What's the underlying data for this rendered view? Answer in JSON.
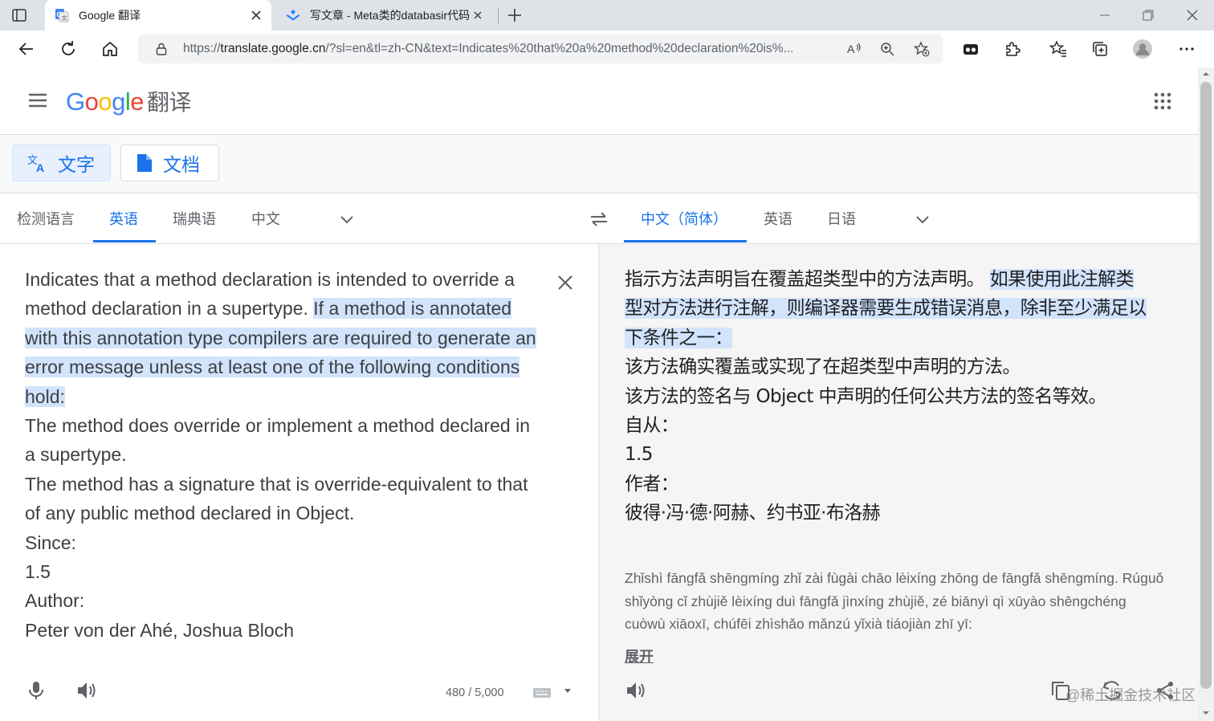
{
  "browser": {
    "tabs": [
      {
        "title": "Google 翻译",
        "active": true
      },
      {
        "title": "写文章 - Meta类的databasir代码",
        "active": false
      }
    ],
    "url_prefix": "https://",
    "url_host": "translate.google.cn",
    "url_rest": "/?sl=en&tl=zh-CN&text=Indicates%20that%20a%20method%20declaration%20is%..."
  },
  "header": {
    "logo_google": "Google",
    "logo_product": "翻译"
  },
  "modes": [
    {
      "label": "文字",
      "active": true
    },
    {
      "label": "文档",
      "active": false
    }
  ],
  "source_langs": [
    "检测语言",
    "英语",
    "瑞典语",
    "中文"
  ],
  "source_selected": "英语",
  "target_langs": [
    "中文（简体）",
    "英语",
    "日语"
  ],
  "target_selected": "中文（简体）",
  "source": {
    "line1": "Indicates that a method declaration is intended to override a method declaration in a supertype. ",
    "line1_hl": "If a method is annotated with this annotation type compilers are required to generate an error message unless at least one of the following conditions hold:",
    "para2": "The method does override or implement a method declared in a supertype.",
    "para3": "The method has a signature that is override-equivalent to that of any public method declared in Object.",
    "since_label": "Since:",
    "since_value": "1.5",
    "author_label": "Author:",
    "author_value": "Peter von der Ahé, Joshua Bloch",
    "char_count": "480 / 5,000"
  },
  "target": {
    "part1": "指示方法声明旨在覆盖超类型中的方法声明。 ",
    "part1_hl": "如果使用此注解类型对方法进行注解，则编译器需要生成错误消息，除非至少满足以下条件之一：",
    "para2": "该方法确实覆盖或实现了在超类型中声明的方法。",
    "para3": "该方法的签名与 Object 中声明的任何公共方法的签名等效。",
    "since_label": "自从：",
    "since_value": "1.5",
    "author_label": "作者：",
    "author_value": "彼得·冯·德·阿赫、约书亚·布洛赫",
    "transliteration": "Zhǐshì fāngfǎ shēngmíng zhǐ zài fùgài chāo lèixíng zhōng de fāngfǎ shēngmíng. Rúguǒ shǐyòng cǐ zhùjiě lèixíng duì fāngfǎ jìnxíng zhùjiě, zé biānyì qì xūyào shēngchéng cuòwù xiāoxī, chúfēi zhìshǎo mǎnzú yǐxià tiáojiàn zhī yī:",
    "expand_label": "展开"
  },
  "watermark": "@稀土掘金技术社区",
  "colors": {
    "accent": "#1a73e8",
    "highlight": "#d2e3fc"
  },
  "icons": [
    "tab-actions-icon",
    "google-translate-favicon",
    "close-icon",
    "plus-icon",
    "back-icon",
    "reload-icon",
    "home-icon",
    "lock-icon",
    "read-aloud-icon",
    "zoom-icon",
    "favorite-add-icon",
    "extension-icon",
    "puzzle-icon",
    "favorites-icon",
    "collections-icon",
    "profile-icon",
    "more-icon",
    "hamburger-menu-icon",
    "apps-grid-icon",
    "translate-icon",
    "document-icon",
    "chevron-down-icon",
    "swap-languages-icon",
    "microphone-icon",
    "speaker-icon",
    "keyboard-icon",
    "copy-icon",
    "feedback-icon",
    "share-icon"
  ]
}
